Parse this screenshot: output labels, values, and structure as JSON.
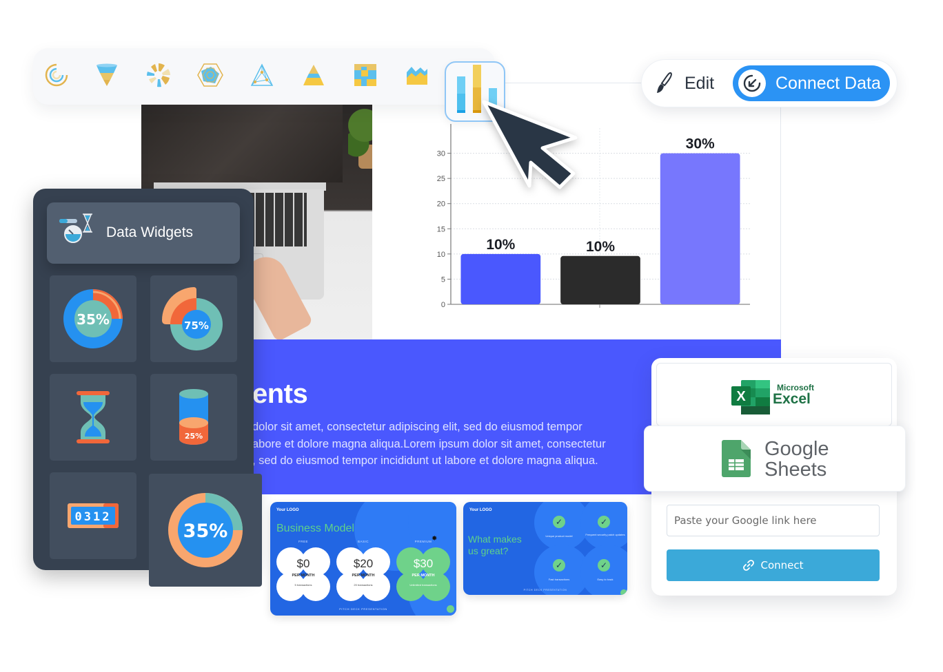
{
  "chart_toolbar": {
    "items": [
      {
        "icon": "radial-bar-chart-icon"
      },
      {
        "icon": "funnel-chart-icon"
      },
      {
        "icon": "polar-area-chart-icon"
      },
      {
        "icon": "radar-chart-icon"
      },
      {
        "icon": "triangle-diagram-icon"
      },
      {
        "icon": "pyramid-chart-icon"
      },
      {
        "icon": "treemap-chart-icon"
      },
      {
        "icon": "area-chart-icon"
      },
      {
        "icon": "bar-chart-icon",
        "selected": true
      }
    ]
  },
  "action_pill": {
    "edit_label": "Edit",
    "connect_label": "Connect Data"
  },
  "slide": {
    "band_title": "ents",
    "band_text": "dolor sit amet, consectetur adipiscing elit, sed do eiusmod tempor\nabore et dolore magna aliqua.Lorem ipsum dolor sit amet, consectetur\n, sed do eiusmod tempor incididunt ut labore et dolore magna aliqua.",
    "band_color": "#4a58fe"
  },
  "chart_data": {
    "type": "bar",
    "title": "",
    "xlabel": "",
    "ylabel": "",
    "categories": [
      "",
      "",
      ""
    ],
    "values": [
      10,
      9.6,
      30
    ],
    "data_labels": [
      "10%",
      "10%",
      "30%"
    ],
    "colors": [
      "#4a58fe",
      "#2b2b2b",
      "#7777fd"
    ],
    "ylim": [
      0,
      35
    ],
    "yticks": [
      0,
      5,
      10,
      15,
      20,
      25,
      30
    ],
    "grid": true
  },
  "widgets_panel": {
    "title": "Data Widgets",
    "widgets": [
      {
        "type": "donut",
        "label": "35%",
        "value": 35
      },
      {
        "type": "pie",
        "label": "75%",
        "value": 75
      },
      {
        "type": "hourglass",
        "label": ""
      },
      {
        "type": "cylinder",
        "label": "25%",
        "value": 25
      },
      {
        "type": "counter",
        "label": "0312"
      },
      {
        "type": "ring",
        "label": "35%",
        "value": 35
      }
    ]
  },
  "thumbnails": {
    "business": {
      "logo": "Your LOGO",
      "title": "Business Model",
      "tiers": [
        {
          "tier": "FREE",
          "price": "$0",
          "per": "PER MONTH",
          "desc": "5 transactions"
        },
        {
          "tier": "BASIC",
          "price": "$20",
          "per": "PER MONTH",
          "desc": "20 transactions"
        },
        {
          "tier": "PREMIUM",
          "price": "$30",
          "per": "PER MONTH",
          "desc": "Unlimited transactions"
        }
      ],
      "footer": "PITCH DECK PRESENTATION"
    },
    "great": {
      "logo": "Your LOGO",
      "title": "What makes us great?",
      "features": [
        "Unique product model",
        "Frequent security patch updates",
        "Fast transactions",
        "Easy to track"
      ],
      "footer": "PITCH DECK PRESENTATION"
    }
  },
  "data_sources": {
    "excel_small": "Microsoft",
    "excel_big": "Excel",
    "sheets_line1": "Google",
    "sheets_line2": "Sheets",
    "link_placeholder": "Paste your Google link here",
    "link_value": "",
    "connect_label": "Connect"
  }
}
